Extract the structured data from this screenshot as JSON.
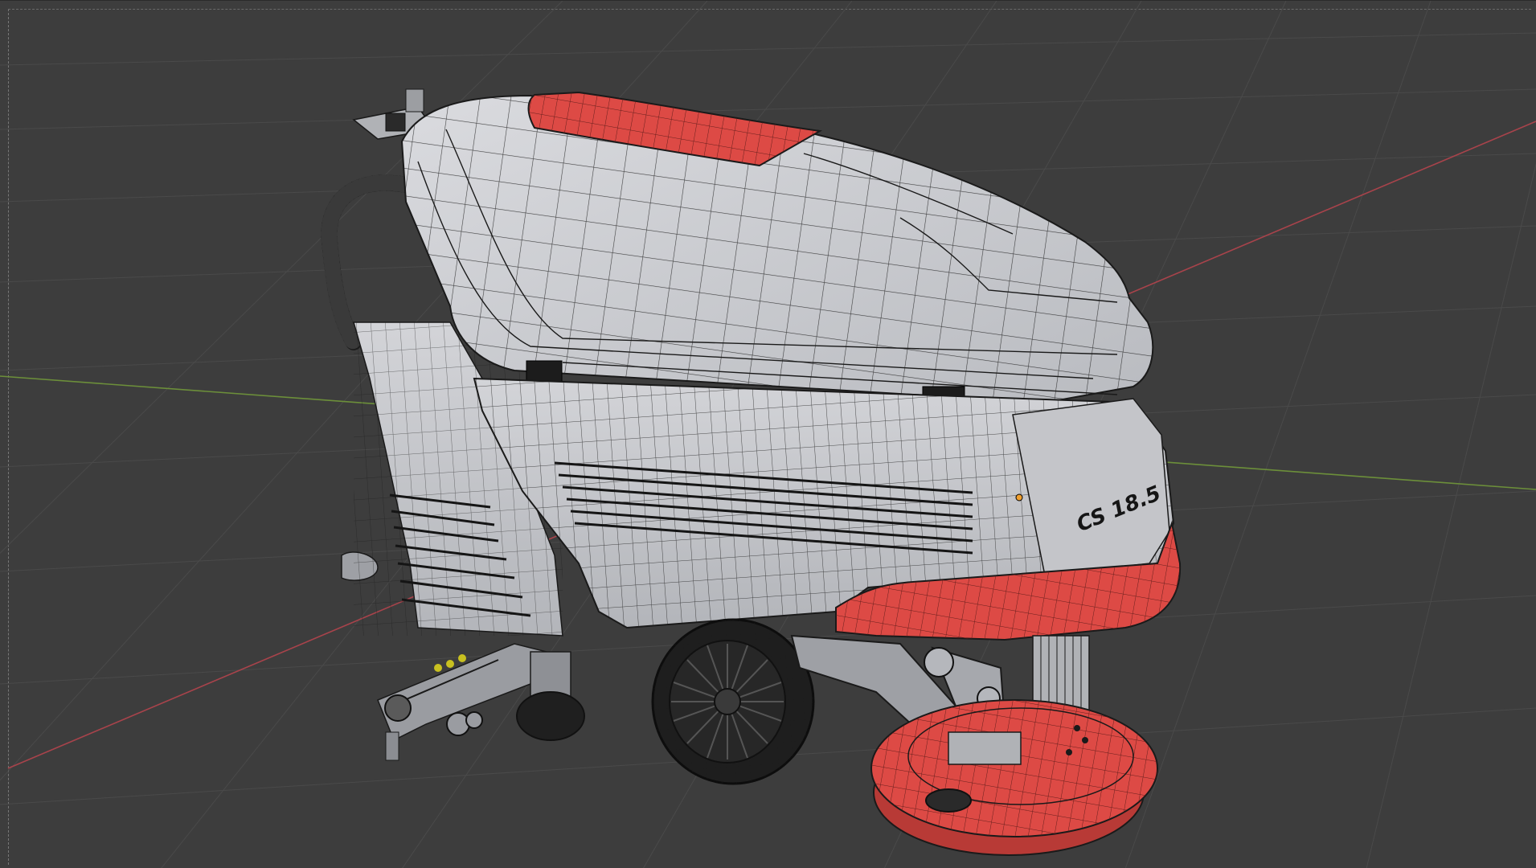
{
  "viewport": {
    "background": "#3d3d3d",
    "grid_color": "#4d4d4d",
    "x_axis_color": "#a8434b",
    "y_axis_color": "#6c8f3a"
  },
  "model": {
    "body_color": "#c9cacd",
    "accent_color": "#dd4a45",
    "wire_color": "#1a1a1a",
    "dark_parts_color": "#262626",
    "logo_text": "CS 18.5",
    "origin_color": "#f0a030"
  }
}
